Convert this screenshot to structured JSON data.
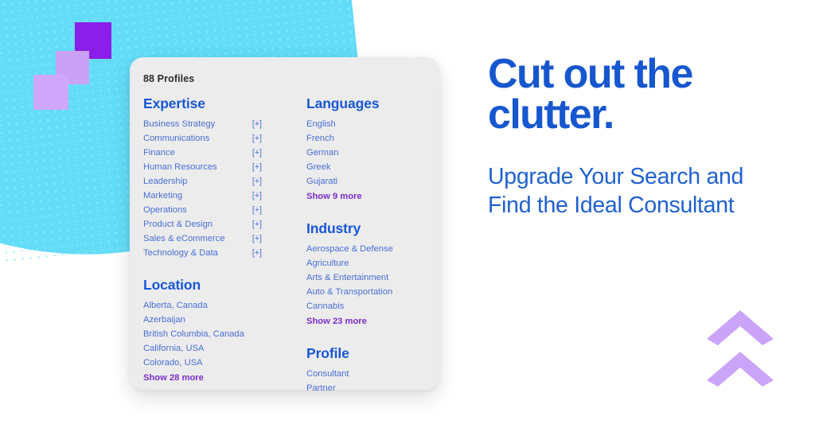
{
  "background": {
    "blob_color": "#63dcf8",
    "page_color": "#ffffff",
    "squares": [
      {
        "name": "square-dark-purple",
        "color": "#8b1ee8"
      },
      {
        "name": "square-mid-purple",
        "color": "#c9a2f5"
      },
      {
        "name": "square-light-purple",
        "color": "#d0a6fb"
      }
    ],
    "chevron_color": "#cba4f9",
    "chevron_icons": [
      "chevron-up-icon",
      "chevron-up-icon"
    ]
  },
  "card": {
    "title": "88 Profiles",
    "accent_heading_color": "#1856d6",
    "item_color": "#4a6fd4",
    "show_more_color": "#7b2ecb",
    "sections": [
      {
        "id": "expertise",
        "heading": "Expertise",
        "items": [
          {
            "label": "Business Strategy",
            "toggle": "[+]"
          },
          {
            "label": "Communications",
            "toggle": "[+]"
          },
          {
            "label": "Finance",
            "toggle": "[+]"
          },
          {
            "label": "Human Resources",
            "toggle": "[+]"
          },
          {
            "label": "Leadership",
            "toggle": "[+]"
          },
          {
            "label": "Marketing",
            "toggle": "[+]"
          },
          {
            "label": "Operations",
            "toggle": "[+]"
          },
          {
            "label": "Product & Design",
            "toggle": "[+]"
          },
          {
            "label": "Sales & eCommerce",
            "toggle": "[+]"
          },
          {
            "label": "Technology & Data",
            "toggle": "[+]"
          }
        ],
        "show_more": ""
      },
      {
        "id": "location",
        "heading": "Location",
        "items": [
          {
            "label": "Alberta, Canada",
            "toggle": ""
          },
          {
            "label": "Azerbaijan",
            "toggle": ""
          },
          {
            "label": "British Columbia, Canada",
            "toggle": ""
          },
          {
            "label": "California, USA",
            "toggle": ""
          },
          {
            "label": "Colorado, USA",
            "toggle": ""
          }
        ],
        "show_more": "Show 28 more"
      },
      {
        "id": "languages",
        "heading": "Languages",
        "items": [
          {
            "label": "English",
            "toggle": ""
          },
          {
            "label": "French",
            "toggle": ""
          },
          {
            "label": "German",
            "toggle": ""
          },
          {
            "label": "Greek",
            "toggle": ""
          },
          {
            "label": "Gujarati",
            "toggle": ""
          }
        ],
        "show_more": "Show 9 more"
      },
      {
        "id": "industry",
        "heading": "Industry",
        "items": [
          {
            "label": "Aerospace & Defense",
            "toggle": ""
          },
          {
            "label": "Agriculture",
            "toggle": ""
          },
          {
            "label": "Arts & Entertainment",
            "toggle": ""
          },
          {
            "label": "Auto & Transportation",
            "toggle": ""
          },
          {
            "label": "Cannabis",
            "toggle": ""
          }
        ],
        "show_more": "Show 23 more"
      },
      {
        "id": "profile",
        "heading": "Profile",
        "items": [
          {
            "label": "Consultant",
            "toggle": ""
          },
          {
            "label": "Partner",
            "toggle": ""
          }
        ],
        "show_more": ""
      }
    ]
  },
  "copy": {
    "headline_line_1": "Cut out the",
    "headline_line_2": "clutter.",
    "headline_color": "#1657cf",
    "subhead": "Upgrade Your Search and Find the Ideal Consultant",
    "subhead_color": "#1f61d1"
  }
}
